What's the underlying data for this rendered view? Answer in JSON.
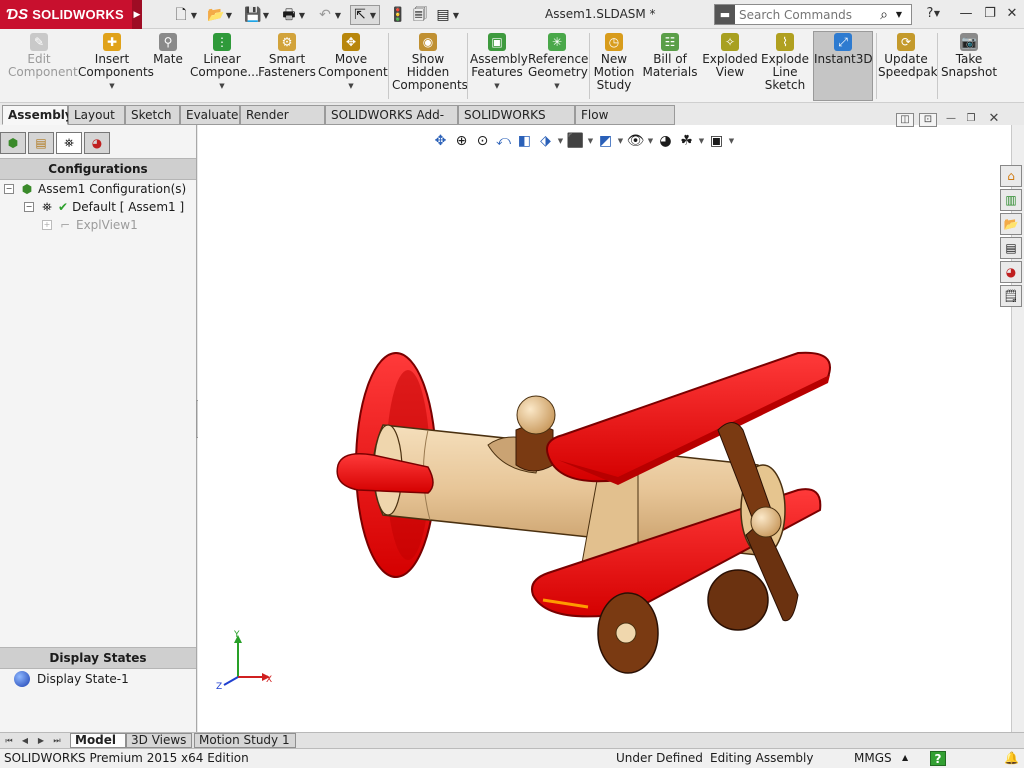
{
  "app": {
    "brand": "SOLIDWORKS",
    "doc_title": "Assem1.SLDASM *"
  },
  "search": {
    "placeholder": "Search Commands"
  },
  "ribbon": {
    "buttons": [
      {
        "label_1": "Edit",
        "label_2": "Component",
        "label_3": "",
        "icon": "edit-component-icon"
      },
      {
        "label_1": "Insert",
        "label_2": "Components",
        "label_3": "",
        "icon": "insert-components-icon"
      },
      {
        "label_1": "Mate",
        "label_2": "",
        "label_3": "",
        "icon": "mate-icon"
      },
      {
        "label_1": "Linear",
        "label_2": "Compone...",
        "label_3": "",
        "icon": "linear-pattern-icon"
      },
      {
        "label_1": "Smart",
        "label_2": "Fasteners",
        "label_3": "",
        "icon": "smart-fasteners-icon"
      },
      {
        "label_1": "Move",
        "label_2": "Component",
        "label_3": "",
        "icon": "move-component-icon"
      },
      {
        "label_1": "Show",
        "label_2": "Hidden",
        "label_3": "Components",
        "icon": "show-hidden-icon"
      },
      {
        "label_1": "Assembly",
        "label_2": "Features",
        "label_3": "",
        "icon": "assembly-features-icon"
      },
      {
        "label_1": "Reference",
        "label_2": "Geometry",
        "label_3": "",
        "icon": "reference-geometry-icon"
      },
      {
        "label_1": "New",
        "label_2": "Motion",
        "label_3": "Study",
        "icon": "new-motion-study-icon"
      },
      {
        "label_1": "Bill of",
        "label_2": "Materials",
        "label_3": "",
        "icon": "bill-of-materials-icon"
      },
      {
        "label_1": "Exploded",
        "label_2": "View",
        "label_3": "",
        "icon": "exploded-view-icon"
      },
      {
        "label_1": "Explode",
        "label_2": "Line",
        "label_3": "Sketch",
        "icon": "explode-line-sketch-icon"
      },
      {
        "label_1": "Instant3D",
        "label_2": "",
        "label_3": "",
        "icon": "instant3d-icon"
      },
      {
        "label_1": "Update",
        "label_2": "Speedpak",
        "label_3": "",
        "icon": "update-speedpak-icon"
      },
      {
        "label_1": "Take",
        "label_2": "Snapshot",
        "label_3": "",
        "icon": "take-snapshot-icon"
      }
    ]
  },
  "command_tabs": [
    "Assembly",
    "Layout",
    "Sketch",
    "Evaluate",
    "Render Tools",
    "SOLIDWORKS Add-Ins",
    "SOLIDWORKS MBD",
    "Flow Simulation"
  ],
  "config_panel": {
    "header": "Configurations",
    "root": "Assem1 Configuration(s)",
    "default_config": "Default [ Assem1 ]",
    "explode_view": "ExplView1"
  },
  "display_states": {
    "header": "Display States",
    "item": "Display State-1"
  },
  "bottom_tabs": [
    "Model",
    "3D Views",
    "Motion Study 1"
  ],
  "status": {
    "edition": "SOLIDWORKS Premium 2015 x64 Edition",
    "state": "Under Defined",
    "mode": "Editing Assembly",
    "units": "MMGS",
    "help": "?"
  },
  "colors": {
    "brand_red": "#c8102e",
    "plane_red": "#ee1111",
    "wood": "#e9c99b",
    "dark_wood": "#7a3a12"
  }
}
